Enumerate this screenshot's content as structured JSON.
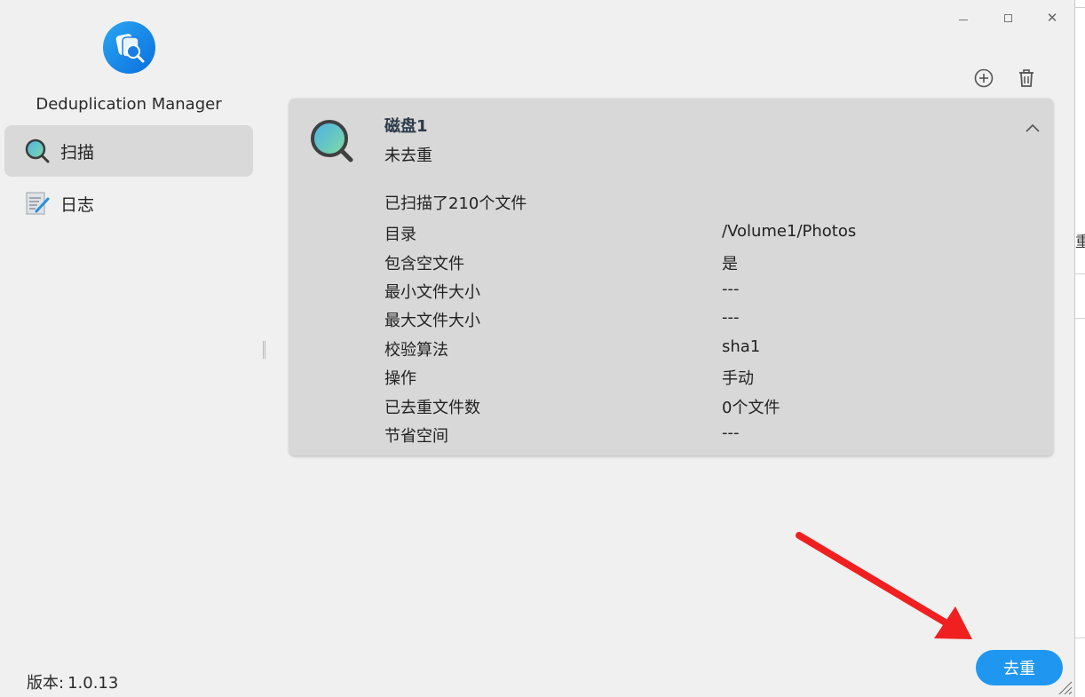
{
  "window": {
    "title": "Deduplication Manager"
  },
  "sidebar": {
    "app_name": "Deduplication Manager",
    "items": [
      {
        "label": "扫描",
        "icon": "magnifier-icon",
        "active": true
      },
      {
        "label": "日志",
        "icon": "notepad-icon",
        "active": false
      }
    ],
    "version_label": "版本:",
    "version_value": "1.0.13"
  },
  "toolbar": {
    "add_icon": "plus-circle-icon",
    "delete_icon": "trash-icon"
  },
  "task": {
    "title": "磁盘1",
    "status": "未去重",
    "scanned_text": "已扫描了210个文件",
    "details": [
      {
        "key": "目录",
        "value": "/Volume1/Photos"
      },
      {
        "key": "包含空文件",
        "value": "是"
      },
      {
        "key": "最小文件大小",
        "value": "---"
      },
      {
        "key": "最大文件大小",
        "value": "---"
      },
      {
        "key": "校验算法",
        "value": "sha1"
      },
      {
        "key": "操作",
        "value": "手动"
      },
      {
        "key": "已去重文件数",
        "value": "0个文件"
      },
      {
        "key": "节省空间",
        "value": "---"
      }
    ]
  },
  "action_button": {
    "label": "去重"
  },
  "background_fragment": "重",
  "colors": {
    "accent": "#1f97f0",
    "arrow": "#f02020",
    "card": "#d8d8d8",
    "selected": "#d9d9d9"
  }
}
